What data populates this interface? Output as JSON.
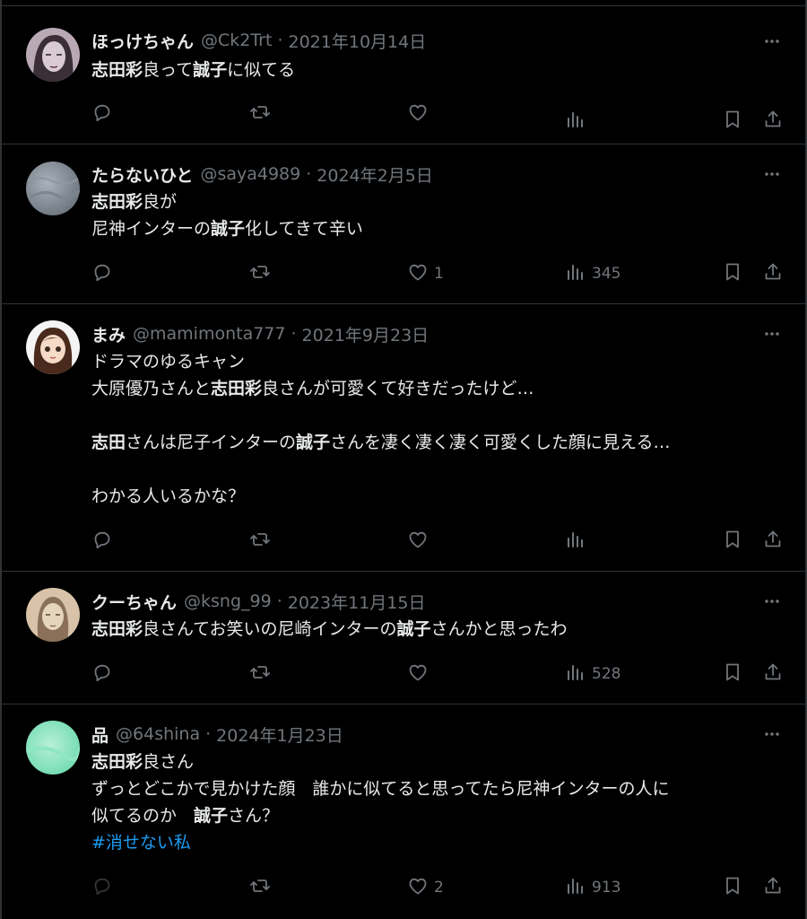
{
  "tweets": [
    {
      "name": "ほっけちゃん",
      "handle": "@Ck2Trt",
      "date": "2021年10月14日",
      "lines": [
        [
          {
            "t": "志田彩",
            "b": true
          },
          {
            "t": "良って",
            "b": false
          },
          {
            "t": "誠子",
            "b": true
          },
          {
            "t": "に似てる",
            "b": false
          }
        ]
      ],
      "likes": "",
      "views": ""
    },
    {
      "name": "たらないひと",
      "handle": "@saya4989",
      "date": "2024年2月5日",
      "lines": [
        [
          {
            "t": "志田彩",
            "b": true
          },
          {
            "t": "良が",
            "b": false
          }
        ],
        [
          {
            "t": "尼神インターの",
            "b": false
          },
          {
            "t": "誠子",
            "b": true
          },
          {
            "t": "化してきて辛い",
            "b": false
          }
        ]
      ],
      "likes": "1",
      "views": "345"
    },
    {
      "name": "まみ",
      "handle": "@mamimonta777",
      "date": "2021年9月23日",
      "lines": [
        [
          {
            "t": "ドラマのゆるキャン",
            "b": false
          }
        ],
        [
          {
            "t": "大原優乃さんと",
            "b": false
          },
          {
            "t": "志田彩",
            "b": true
          },
          {
            "t": "良さんが可愛くて好きだったけど…",
            "b": false
          }
        ],
        [],
        [
          {
            "t": "志田",
            "b": true
          },
          {
            "t": "さんは尼子インターの",
            "b": false
          },
          {
            "t": "誠子",
            "b": true
          },
          {
            "t": "さんを凄く凄く凄く可愛くした顔に見える…",
            "b": false
          }
        ],
        [],
        [
          {
            "t": "わかる人いるかな？",
            "b": false
          }
        ]
      ],
      "likes": "",
      "views": ""
    },
    {
      "name": "クーちゃん",
      "handle": "@ksng_99",
      "date": "2023年11月15日",
      "lines": [
        [
          {
            "t": "志田彩",
            "b": true
          },
          {
            "t": "良さんてお笑いの尼崎インターの",
            "b": false
          },
          {
            "t": "誠子",
            "b": true
          },
          {
            "t": "さんかと思ったわ",
            "b": false
          }
        ]
      ],
      "likes": "",
      "views": "528"
    },
    {
      "name": "品",
      "handle": "@64shina",
      "date": "2024年1月23日",
      "lines": [
        [
          {
            "t": "志田彩",
            "b": true
          },
          {
            "t": "良さん",
            "b": false
          }
        ],
        [
          {
            "t": "ずっとどこかで見かけた顔　誰かに似てると思ってたら尼神インターの人に",
            "b": false
          }
        ],
        [
          {
            "t": "似てるのか　",
            "b": false
          },
          {
            "t": "誠子",
            "b": true
          },
          {
            "t": "さん？",
            "b": false
          }
        ],
        [
          {
            "t": "#消せない私",
            "b": false,
            "tag": true
          }
        ]
      ],
      "likes": "2",
      "views": "913"
    }
  ],
  "ui": {
    "separator": "·"
  },
  "colors": {
    "background": "#000000",
    "text": "#e7e9ea",
    "muted": "#71767b",
    "link": "#1d9bf0",
    "border": "#2f3336"
  },
  "icons": [
    "more-icon",
    "reply-icon",
    "retweet-icon",
    "like-icon",
    "views-icon",
    "bookmark-icon",
    "share-icon"
  ]
}
